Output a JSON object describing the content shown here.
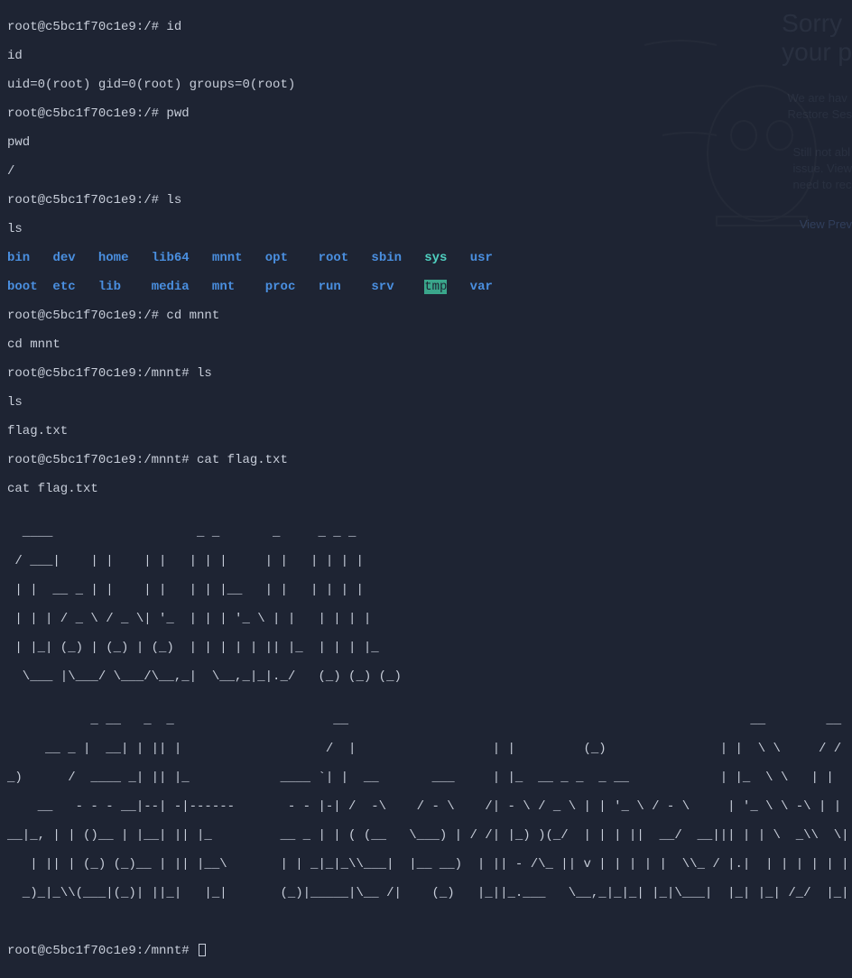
{
  "bg": {
    "heading_line1": "Sorry",
    "heading_line2": "your p",
    "para1_line1": "We are hav",
    "para1_line2": "Restore Ses",
    "para2_line1": "Still not abl",
    "para2_line2": "issue. View",
    "para2_line3": "need to rec",
    "link": "View Prev"
  },
  "session": {
    "line1": "root@c5bc1f70c1e9:/# id",
    "line2": "id",
    "line3": "uid=0(root) gid=0(root) groups=0(root)",
    "line4": "root@c5bc1f70c1e9:/# pwd",
    "line5": "pwd",
    "line6": "/",
    "line7": "root@c5bc1f70c1e9:/# ls",
    "line8": "ls"
  },
  "ls": {
    "row1": {
      "bin": "bin",
      "dev": "dev",
      "home": "home",
      "lib64": "lib64",
      "mnnt": "mnnt",
      "opt": "opt",
      "root": "root",
      "sbin": "sbin",
      "sys": "sys",
      "usr": "usr"
    },
    "row2": {
      "boot": "boot",
      "etc": "etc",
      "lib": "lib",
      "media": "media",
      "mnt": "mnt",
      "proc": "proc",
      "run": "run",
      "srv": "srv",
      "tmp": "tmp",
      "var": "var"
    }
  },
  "session2": {
    "line1": "root@c5bc1f70c1e9:/# cd mnnt",
    "line2": "cd mnnt",
    "line3": "root@c5bc1f70c1e9:/mnnt# ls",
    "line4": "ls",
    "line5": "flag.txt",
    "line6": "root@c5bc1f70c1e9:/mnnt# cat flag.txt",
    "line7": "cat flag.txt"
  },
  "ascii": {
    "l1": "  ____                   _ _       _     _ _ _       ",
    "l2": " / ___|    | |    | |   | | |     | |   | | | |      ",
    "l3": " | |  __ _ | |    | |   | | |__   | |   | | | |      ",
    "l4": " | | | / _ \\ / _ \\| '_  | | | '_ \\ | |   | | | |      ",
    "l5": " | |_| (_) | (_) | (_)  | | | | | || |_  | | | |_     ",
    "l6": "  \\___ |\\___/ \\___/\\__,_|  \\__,_|_|._/   (_) (_) (_)  ",
    "l7": "",
    "l8": "           _ __   _  _                     __                                                     __        __",
    "l9": "     __ _ |  __| | || |                   /  |                  | |         (_)               | |  \\ \\     / /",
    "l10": "_)      /  ____ _| || |_            ____ `| |  __       ___     | |_  __ _ _  _ __            | |_  \\ \\   | |",
    "l11": "    __   - - - __|--| -|------       - - |-| /  -\\    / - \\    /| - \\ / _ \\ | | '_ \\ / - \\     | '_ \\ \\ -\\ | |",
    "l12": "__|_, | | ()__ | |__| || |_         __ _ | | ( (__   \\___) | / /| |_) )(_/  | | | ||  __/  __||| | | \\  _\\\\  \\|",
    "l13": "   | || | (_) (_)__ | || |__\\       | | _|_|_\\\\___|  |__ __)  | || - /\\_ || v | | | | |  \\\\_ / |.|  | | | | | |",
    "l14": "  _)_|_\\\\(___|(_)| ||_|   |_|       (_)|_____|\\__ /|    (_)   |_||_.___   \\__,_|_|_| |_|\\___|  |_| |_| /_/  |_|",
    "l15": ""
  },
  "final_prompt": "root@c5bc1f70c1e9:/mnnt# "
}
